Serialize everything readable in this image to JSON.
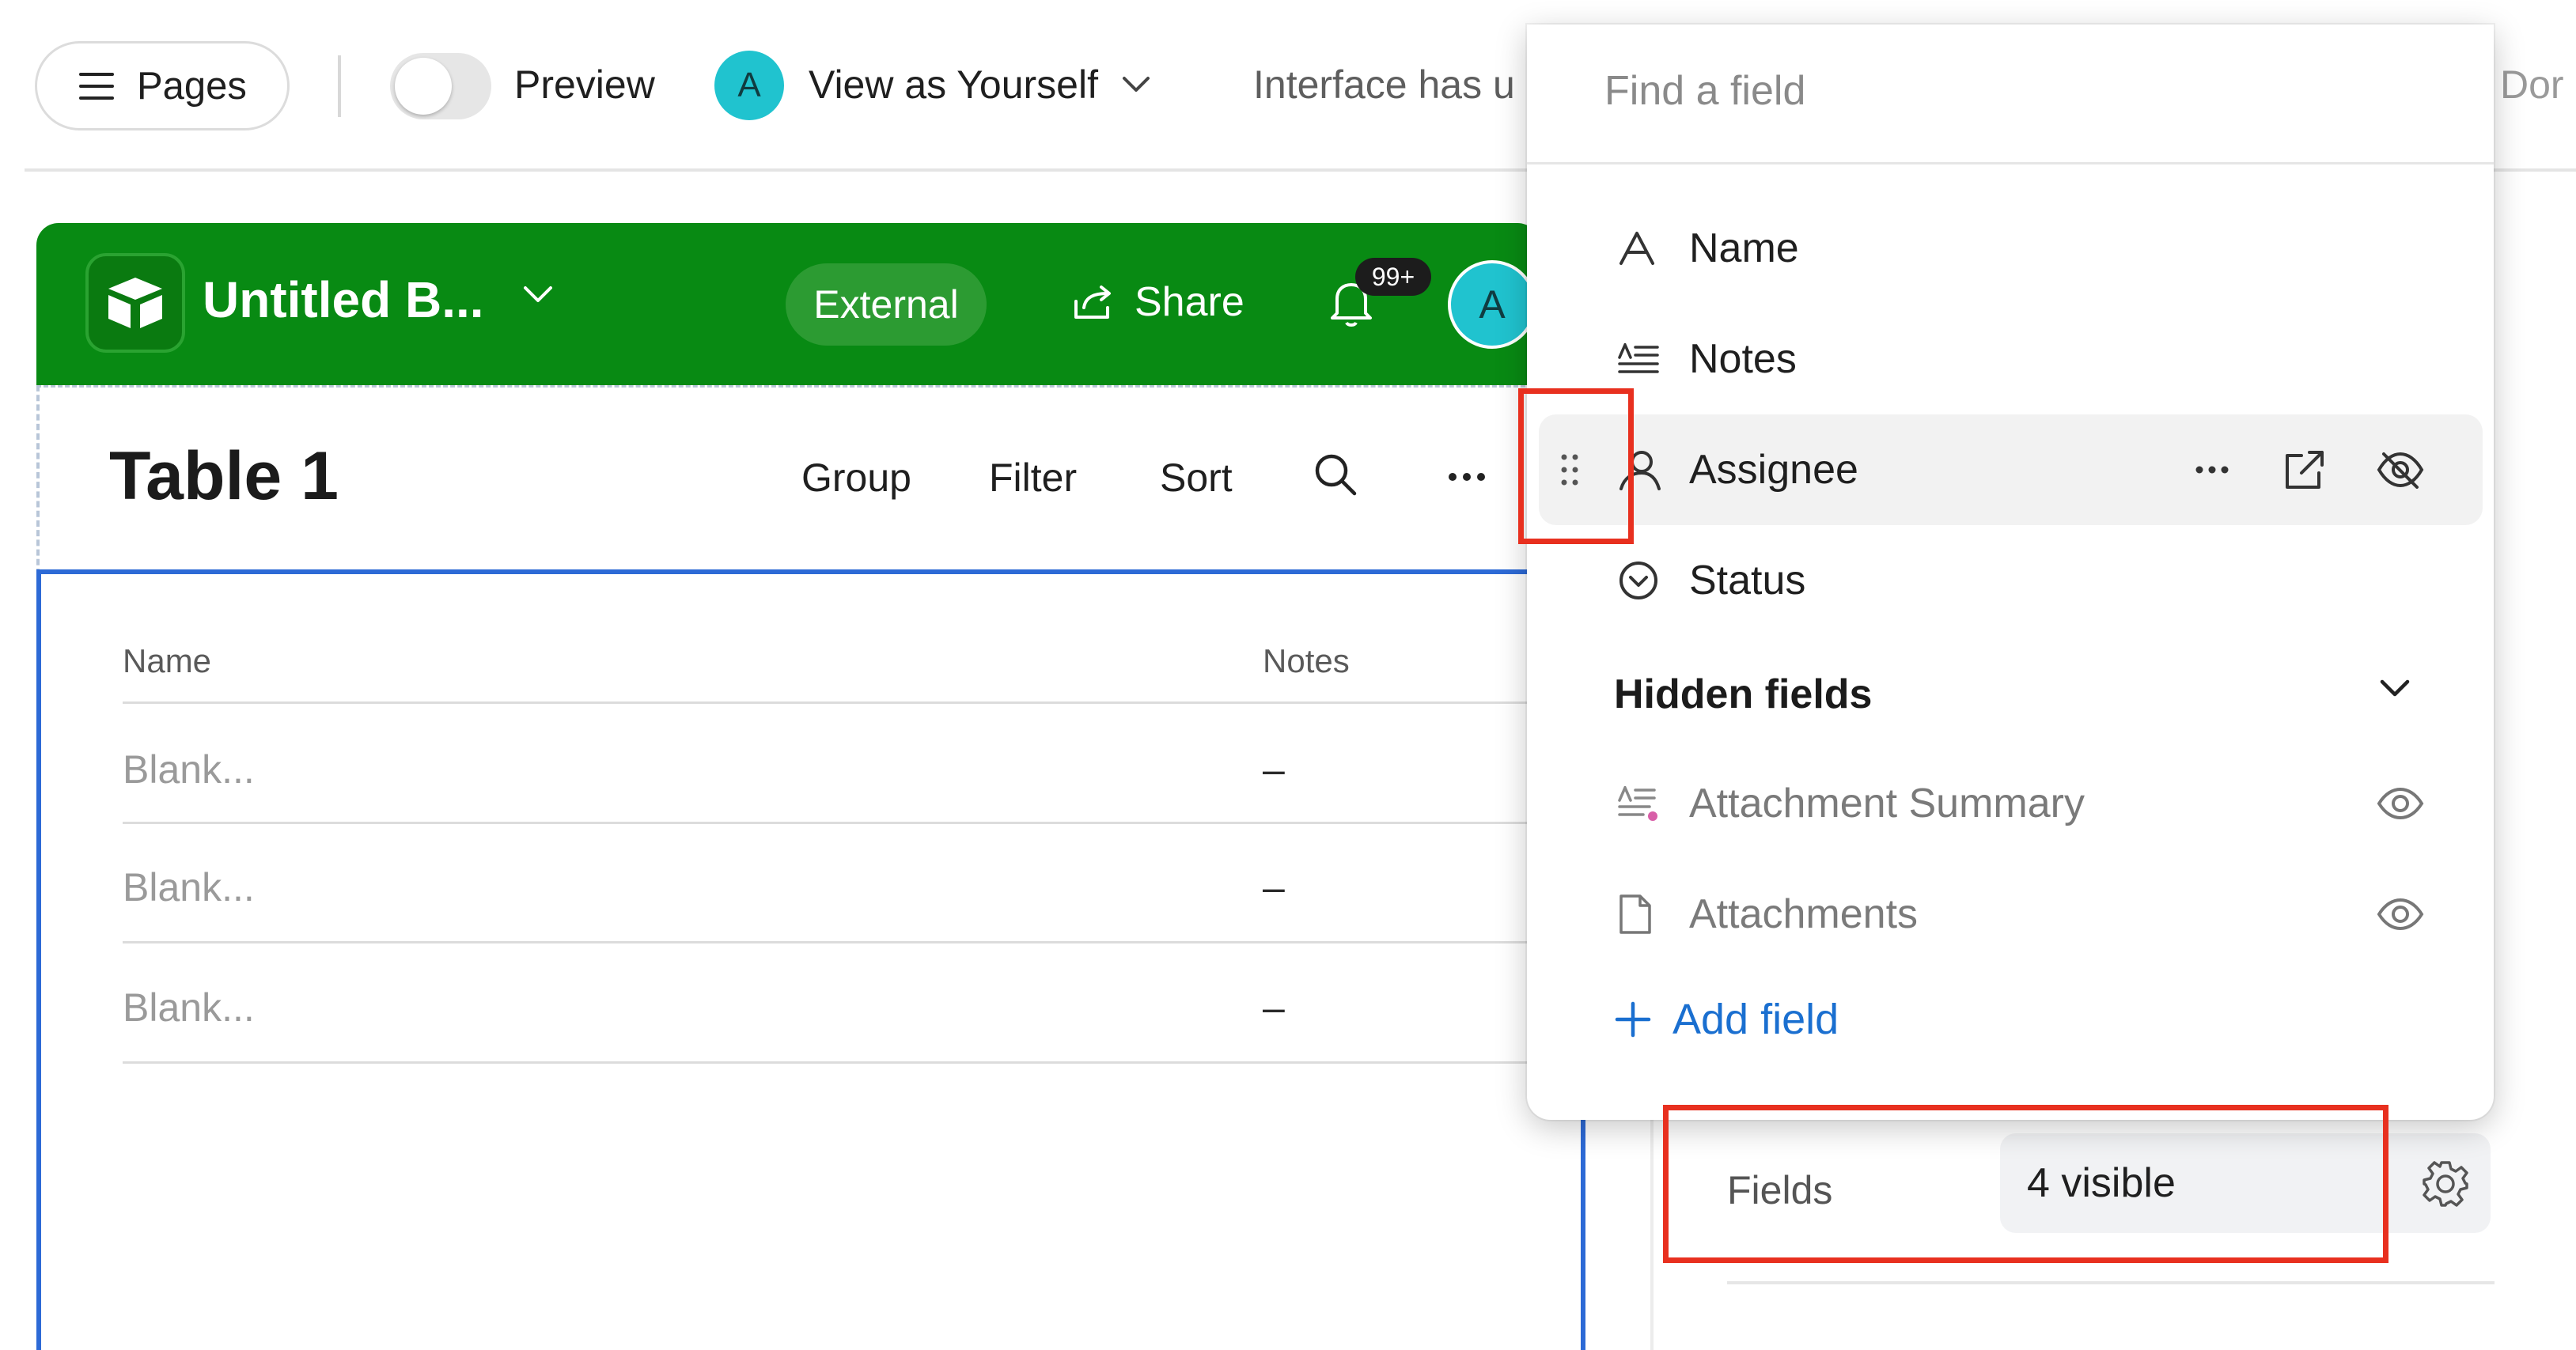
{
  "topbar": {
    "pages_label": "Pages",
    "preview_label": "Preview",
    "avatar_initial": "A",
    "view_as_label": "View as Yourself",
    "interface_note": "Interface has u",
    "done_partial": "Dor"
  },
  "app": {
    "base_name": "Untitled B...",
    "external_label": "External",
    "share_label": "Share",
    "notifications_badge": "99+",
    "avatar_initial": "A",
    "brand_color": "#088a13"
  },
  "table": {
    "title": "Table 1",
    "toolbar": [
      "Group",
      "Filter",
      "Sort"
    ],
    "columns": [
      "Name",
      "Notes"
    ],
    "rows": [
      {
        "name": "Blank...",
        "notes": "–"
      },
      {
        "name": "Blank...",
        "notes": "–"
      },
      {
        "name": "Blank...",
        "notes": "–"
      }
    ]
  },
  "field_picker": {
    "search_placeholder": "Find a field",
    "visible_fields": [
      {
        "label": "Name",
        "icon": "text-type-icon"
      },
      {
        "label": "Notes",
        "icon": "long-text-icon"
      },
      {
        "label": "Assignee",
        "icon": "user-icon"
      },
      {
        "label": "Status",
        "icon": "single-select-icon"
      }
    ],
    "hidden_section_label": "Hidden fields",
    "hidden_fields": [
      {
        "label": "Attachment Summary",
        "icon": "ai-text-icon"
      },
      {
        "label": "Attachments",
        "icon": "file-icon"
      }
    ],
    "add_field_label": "Add field"
  },
  "properties": {
    "fields_label": "Fields",
    "fields_value": "4 visible"
  },
  "colors": {
    "accent_blue": "#1a6fd0",
    "highlight_red": "#e8301f",
    "avatar_teal": "#20c3cf"
  }
}
